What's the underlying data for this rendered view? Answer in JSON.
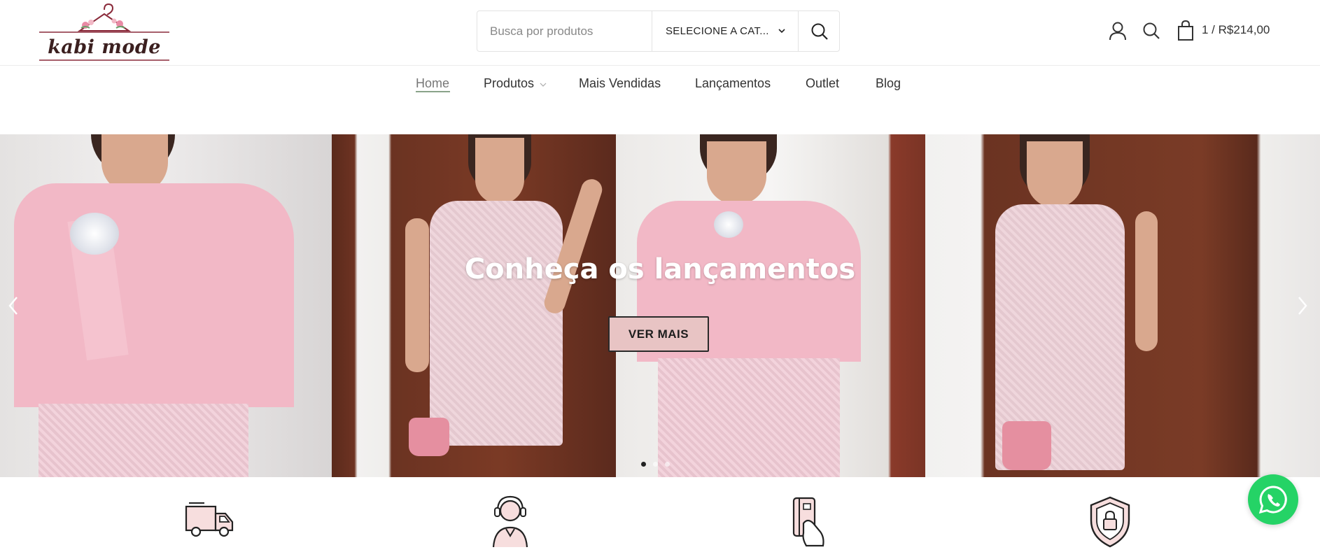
{
  "brand": {
    "logo_text": "kabi mode"
  },
  "search": {
    "placeholder": "Busca por produtos",
    "category_label": "SELECIONE A CAT..."
  },
  "header": {
    "cart_summary": "1 / R$214,00",
    "icons": [
      "user-icon",
      "search-icon",
      "shopping-bag-icon"
    ]
  },
  "nav": {
    "items": [
      {
        "label": "Home",
        "active": true
      },
      {
        "label": "Produtos",
        "has_dropdown": true
      },
      {
        "label": "Mais Vendidas"
      },
      {
        "label": "Lançamentos"
      },
      {
        "label": "Outlet"
      },
      {
        "label": "Blog"
      }
    ]
  },
  "hero": {
    "title": "Conheça os lançamentos",
    "button_label": "VER MAIS",
    "slide_count": 3,
    "active_slide": 1
  },
  "features": {
    "icons": [
      "delivery-truck-icon",
      "customer-support-icon",
      "card-payment-icon",
      "security-shield-icon"
    ]
  },
  "colors": {
    "accent_button": "#e8c4c4",
    "whatsapp": "#25d366",
    "nav_underline": "#8aa38a"
  }
}
